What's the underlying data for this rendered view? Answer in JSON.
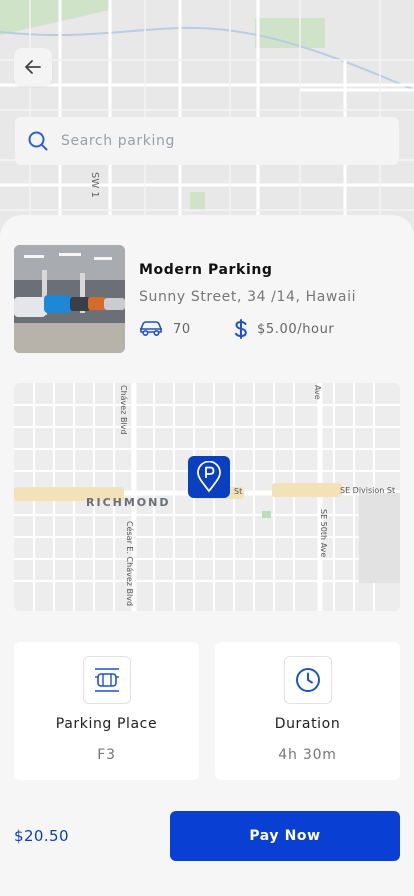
{
  "header": {
    "back_icon": "arrow-left-icon",
    "search": {
      "placeholder": "Search parking",
      "value": "",
      "icon": "search-icon"
    },
    "street_label": "SW 1"
  },
  "parking": {
    "name": "Modern Parking",
    "address": "Sunny Street, 34 /14, Hawaii",
    "spots": "70",
    "price": "$5.00/hour",
    "spots_icon": "car-icon",
    "price_icon": "dollar-icon"
  },
  "map": {
    "labels": [
      "Chávez Blvd",
      "Ave",
      "St",
      "SE Division St",
      "RICHMOND",
      "César E. Chávez Blvd",
      "SE 50th Ave"
    ],
    "pin_icon": "parking-pin-icon"
  },
  "details": [
    {
      "label": "Parking Place",
      "value": "F3",
      "icon": "parking-slot-icon"
    },
    {
      "label": "Duration",
      "value": "4h 30m",
      "icon": "clock-icon"
    }
  ],
  "footer": {
    "total": "$20.50",
    "pay_label": "Pay Now"
  },
  "colors": {
    "primary": "#0a3fd4",
    "text_primary_price": "#0b3fbf"
  }
}
